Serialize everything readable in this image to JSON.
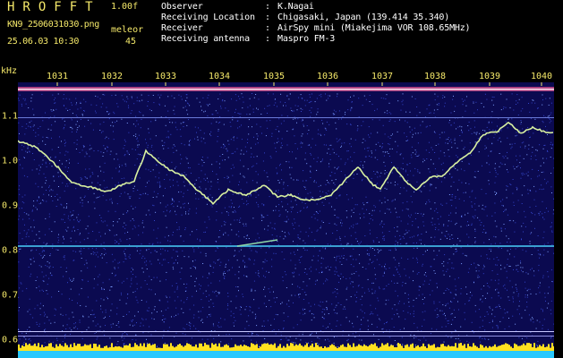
{
  "header": {
    "app_title": "HROFFT",
    "version": "1.00f",
    "filename": "KN9_2506031030.png",
    "mode": "meleor",
    "timestamp": "25.06.03 10:30",
    "count": "45",
    "info": [
      {
        "key": "Observer",
        "value": "K.Nagai"
      },
      {
        "key": "Receiving Location",
        "value": "Chigasaki, Japan (139.414 35.340)"
      },
      {
        "key": "Receiver",
        "value": "AirSpy mini (Miakejima VOR 108.65MHz)"
      },
      {
        "key": "Receiving antenna",
        "value": "Maspro FM-3"
      }
    ],
    "colon": ":"
  },
  "spectrogram": {
    "unit": "kHz",
    "time_labels": [
      "1031",
      "1032",
      "1033",
      "1034",
      "1035",
      "1036",
      "1037",
      "1038",
      "1039",
      "1040"
    ],
    "freq_labels": [
      "1.1",
      "1.0",
      "0.9",
      "0.8",
      "0.7",
      "0.6"
    ],
    "colors": {
      "background": "#0b0a50",
      "noise_a": "#3344c8",
      "noise_b": "#7fa0ff",
      "trace": "#d8f0a0",
      "band": "#ffe020",
      "baseline": "#28c8ff"
    }
  }
}
